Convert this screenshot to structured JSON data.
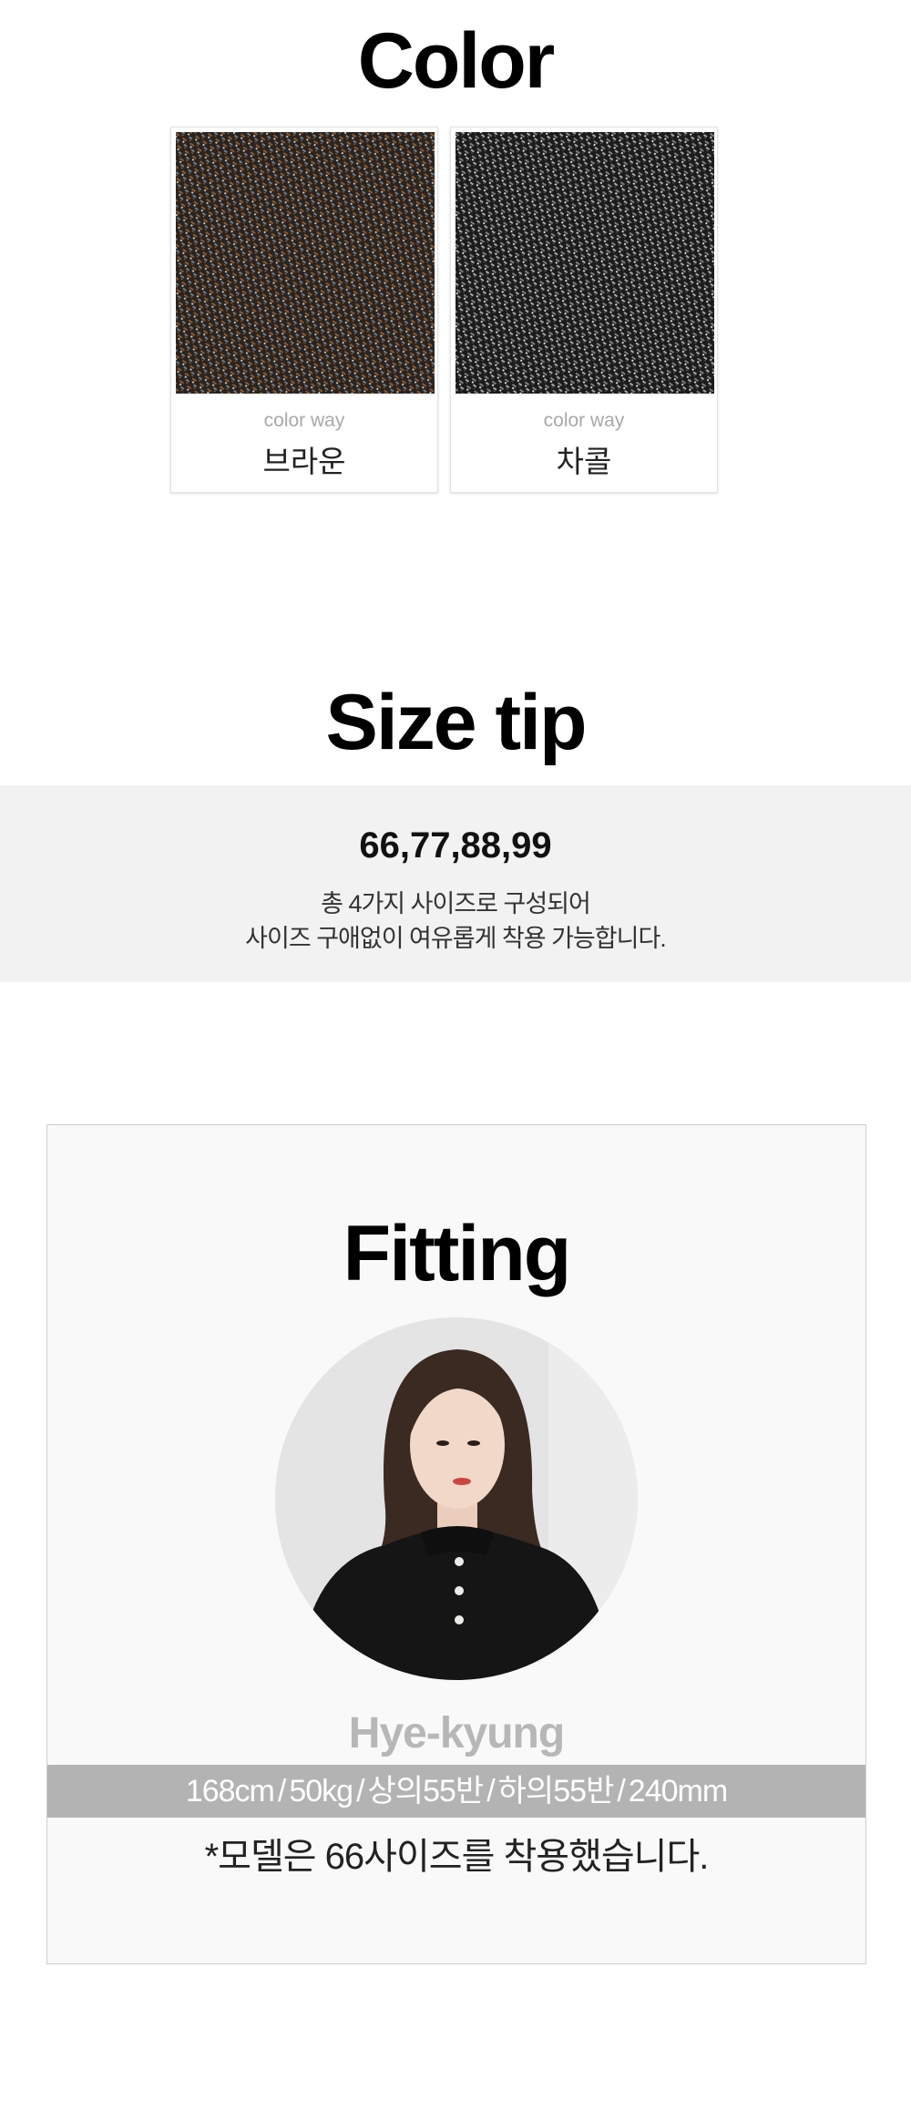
{
  "color_section": {
    "title": "Color",
    "swatches": [
      {
        "subtitle": "color way",
        "name": "브라운",
        "base_color": "#2b2520",
        "accent_color": "#8a5a32"
      },
      {
        "subtitle": "color way",
        "name": "차콜",
        "base_color": "#1e1e1e",
        "accent_color": "#8c8c8c"
      }
    ]
  },
  "size_section": {
    "title": "Size tip",
    "sizes": "66,77,88,99",
    "line1": "총 4가지 사이즈로 구성되어",
    "line2": "사이즈 구애없이 여유롭게 착용 가능합니다."
  },
  "fitting_section": {
    "title": "Fitting",
    "model_name": "Hye-kyung",
    "stats": [
      "168cm",
      "50kg",
      "상의55반",
      "하의55반",
      "240mm"
    ],
    "separator": "/",
    "note": "*모델은 66사이즈를 착용했습니다."
  }
}
